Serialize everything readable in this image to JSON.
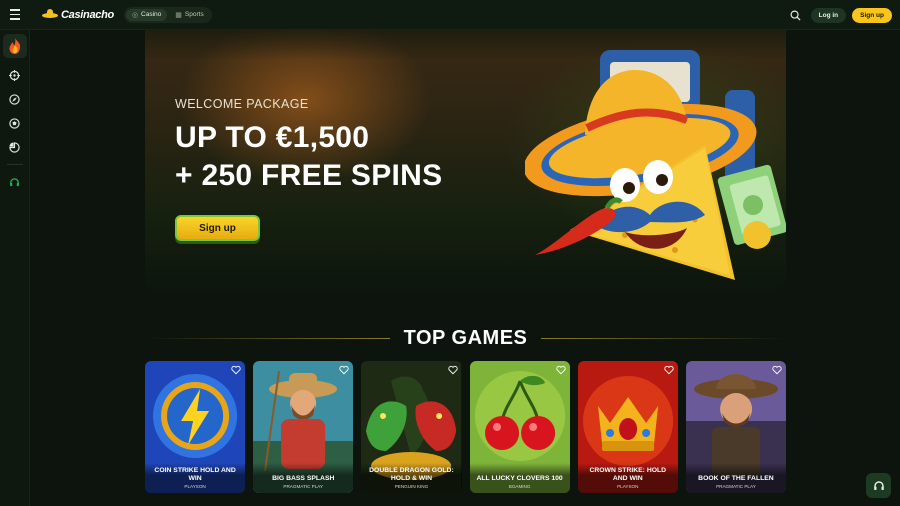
{
  "header": {
    "menu_icon": "hamburger-icon",
    "logo_text": "Casinacho",
    "modes": [
      {
        "label": "Casino",
        "icon": "casino-chip-icon",
        "active": true
      },
      {
        "label": "Sports",
        "icon": "sports-grid-icon",
        "active": false
      }
    ],
    "search_icon": "search-icon",
    "login_label": "Log in",
    "signup_label": "Sign up"
  },
  "sidebar": {
    "items": [
      {
        "name": "hot-games",
        "icon": "flame-icon"
      },
      {
        "name": "live-casino",
        "icon": "target-icon"
      },
      {
        "name": "slots",
        "icon": "compass-icon"
      },
      {
        "name": "sports",
        "icon": "ball-icon"
      },
      {
        "name": "promotions",
        "icon": "chart-icon"
      },
      {
        "name": "support",
        "icon": "headset-icon"
      }
    ]
  },
  "hero": {
    "kicker": "WELCOME PACKAGE",
    "headline_line1": "UP TO €1,500",
    "headline_line2": "+ 250 FREE SPINS",
    "cta_label": "Sign up"
  },
  "top_games": {
    "title": "TOP GAMES",
    "games": [
      {
        "name": "COIN STRIKE HOLD AND WIN",
        "provider": "PLAYSON"
      },
      {
        "name": "BIG BASS SPLASH",
        "provider": "PRAGMATIC PLAY"
      },
      {
        "name": "DOUBLE DRAGON GOLD: HOLD & WIN",
        "provider": "PENGUIN KING"
      },
      {
        "name": "ALL LUCKY CLOVERS 100",
        "provider": "BGAMING"
      },
      {
        "name": "CROWN STRIKE: HOLD AND WIN",
        "provider": "PLAYSON"
      },
      {
        "name": "BOOK OF THE FALLEN",
        "provider": "PRAGMATIC PLAY"
      }
    ]
  },
  "colors": {
    "accent_yellow": "#f7c51b",
    "bg": "#0c140d",
    "support_green": "#1db954"
  }
}
